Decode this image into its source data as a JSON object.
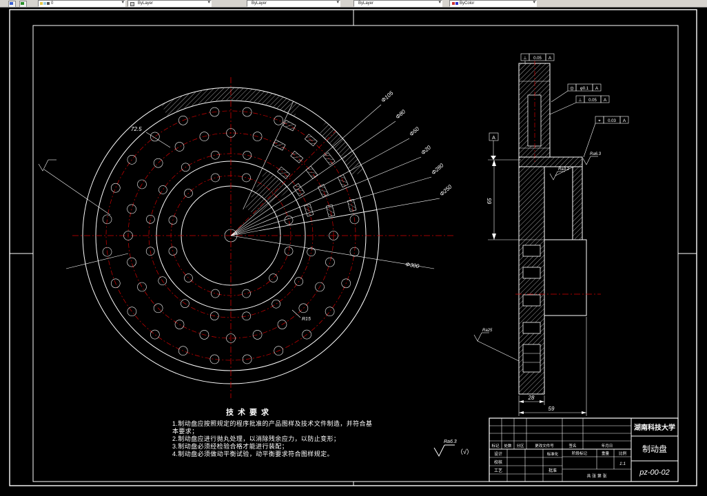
{
  "toolbar": {
    "field1": "0",
    "field2": "ByLayer",
    "field3": "ByLayer",
    "field4": "ByLayer",
    "field5": "ByColor"
  },
  "front_view": {
    "rings": [
      {
        "r": 181,
        "n": 24,
        "offset": 7.5,
        "hole_r": 6.5,
        "skip": [
          10,
          65
        ]
      },
      {
        "r": 149,
        "n": 24,
        "offset": 0,
        "hole_r": 6.5,
        "skip": [
          10,
          65
        ]
      },
      {
        "r": 119,
        "n": 16,
        "offset": 11,
        "hole_r": 6,
        "skip": [
          10,
          65
        ]
      },
      {
        "r": 87,
        "n": 12,
        "offset": 15,
        "hole_r": 6,
        "skip": [
          35,
          65
        ]
      }
    ],
    "phi_labels": [
      "Φ105",
      "Φ80",
      "Φ50",
      "Φ20",
      "Φ280",
      "Φ250"
    ],
    "phi_label_lower": "Φ300",
    "angle_label": "72.5",
    "radius_label": "R15"
  },
  "section_view": {
    "frames": [
      {
        "sym": "⊥",
        "val": "0.05",
        "datum": "A"
      },
      {
        "sym": "◎",
        "val": "φ0.1",
        "datum": "A"
      },
      {
        "sym": "⊥",
        "val": "0.05",
        "datum": "A"
      },
      {
        "sym": "⌖",
        "val": "0.03",
        "datum": "A"
      }
    ],
    "datum_label": "A",
    "dim_height": "65",
    "dim_width_inner": "28",
    "dim_width_outer": "59",
    "rough_right": "Ra6.3",
    "rough_mid": "Ra3.2",
    "rough_left": "Ra25"
  },
  "tech": {
    "title": "技术要求",
    "items": [
      "1.制动盘应按照规定的程序批准的产品图样及技术文件制造，并符合基本要求；",
      "2.制动盘应进行抛丸处理，以消除残余应力，以防止变形；",
      "3.制动盘必须经检验合格才能进行装配；",
      "4.制动盘必须做动平衡试验，动平衡要求符合图样规定。"
    ]
  },
  "general_rough": {
    "label": "Ra6.3",
    "paren": "（√）"
  },
  "title_block": {
    "school": "湖南科技大学",
    "part": "制动盘",
    "drawing_no": "pz-00-02",
    "rev_headers": [
      "标记",
      "处数",
      "分区",
      "更改文件号",
      "签名",
      "年月日"
    ],
    "staff": [
      "设计",
      "校核",
      "工艺"
    ],
    "right_col": [
      "标准化",
      "",
      "批准"
    ],
    "stage": "阶段标记",
    "weight": "重量",
    "scale": "比例",
    "scale_val": "1:1",
    "sheet": "共 张 第 张"
  }
}
